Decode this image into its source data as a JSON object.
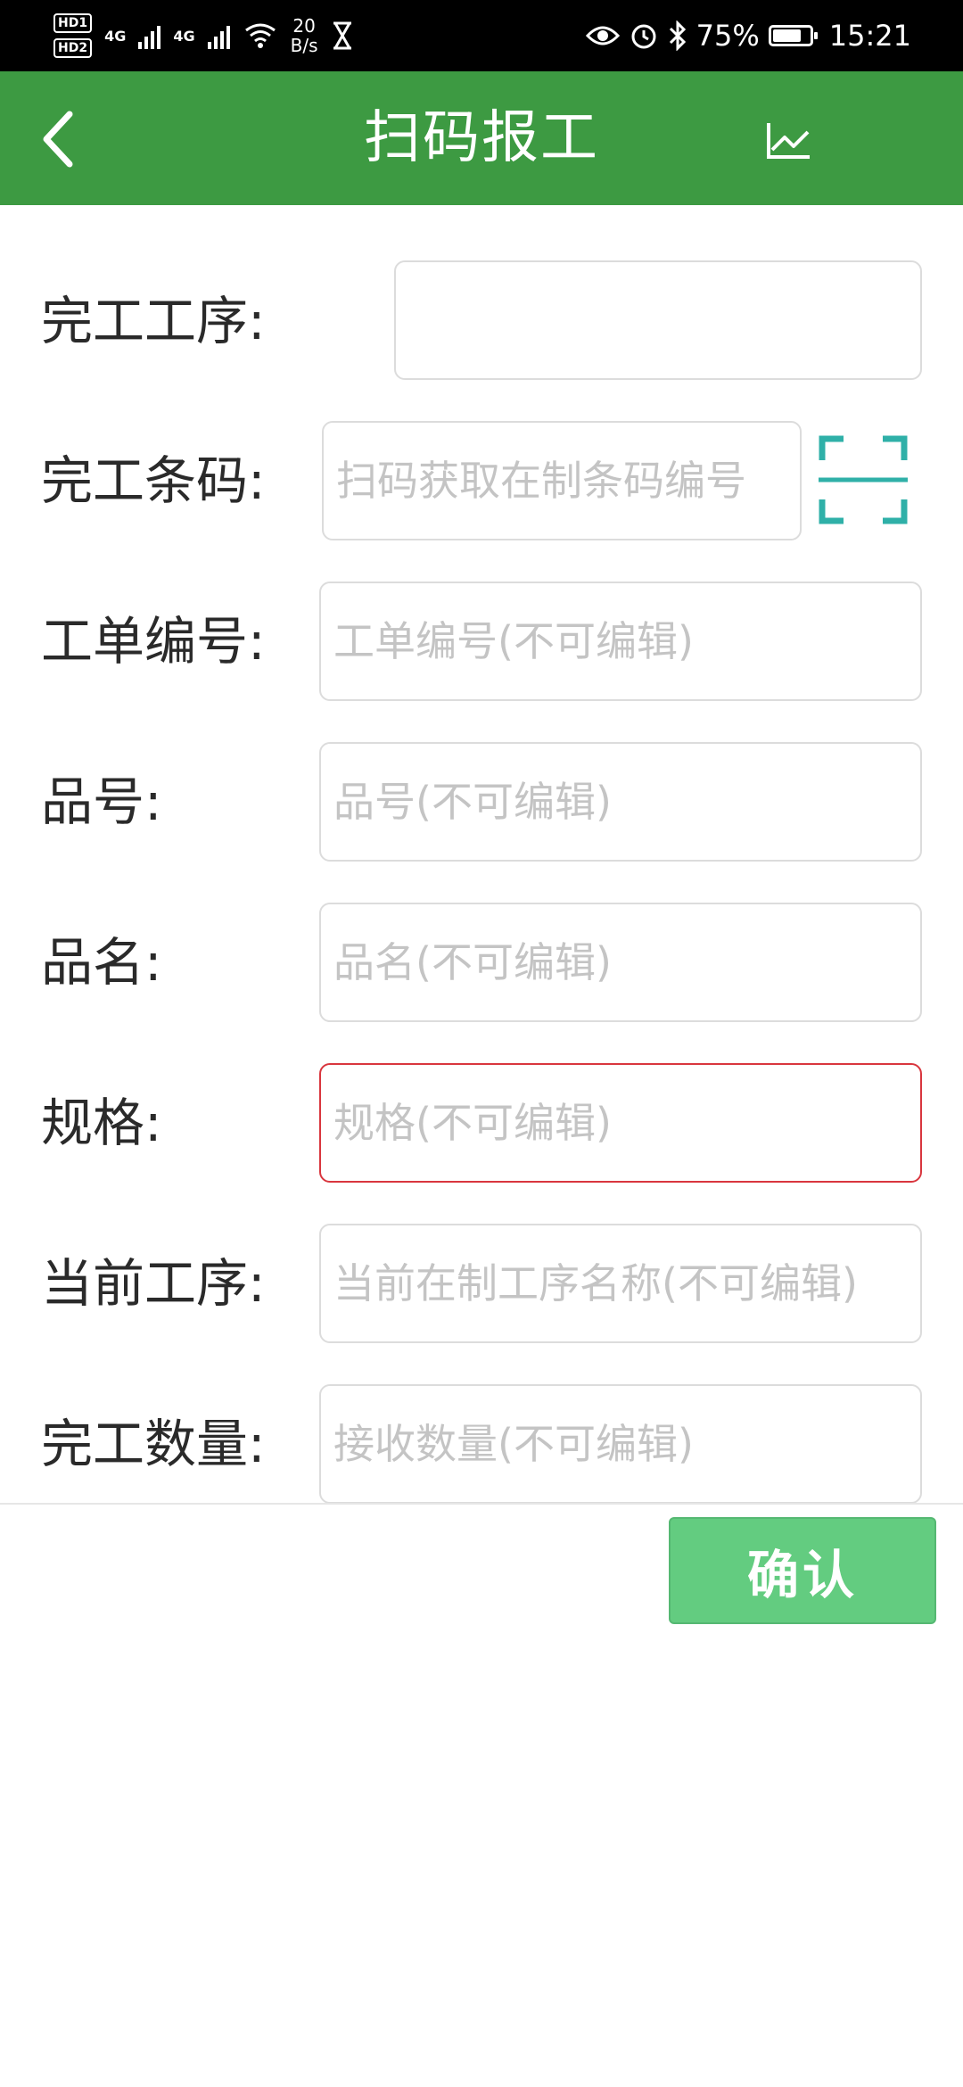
{
  "status_bar": {
    "hd1": "HD1",
    "hd2": "HD2",
    "sig1": "4G",
    "sig2": "4G",
    "speed_value": "20",
    "speed_unit": "B/s",
    "battery": "75%",
    "time": "15:21"
  },
  "app_bar": {
    "title": "扫码报工",
    "back_icon": "chevron-left",
    "chart_icon": "line-chart",
    "color": "#3d9a42"
  },
  "form": {
    "fields": [
      {
        "label": "完工工序:",
        "placeholder": "",
        "value": ""
      },
      {
        "label": "完工条码:",
        "placeholder": "扫码获取在制条码编号",
        "value": ""
      },
      {
        "label": "工单编号:",
        "placeholder": "工单编号(不可编辑)",
        "value": ""
      },
      {
        "label": "品号:",
        "placeholder": "品号(不可编辑)",
        "value": ""
      },
      {
        "label": "品名:",
        "placeholder": "品名(不可编辑)",
        "value": ""
      },
      {
        "label": "规格:",
        "placeholder": "规格(不可编辑)",
        "value": ""
      },
      {
        "label": "当前工序:",
        "placeholder": "当前在制工序名称(不可编辑)",
        "value": ""
      },
      {
        "label": "完工数量:",
        "placeholder": "接收数量(不可编辑)",
        "value": ""
      }
    ],
    "scan_icon": "scan-frame",
    "scan_color": "#2fb0a8",
    "error_color": "#d9363e"
  },
  "actions": {
    "confirm_label": "确认",
    "confirm_color": "#63cc80"
  }
}
